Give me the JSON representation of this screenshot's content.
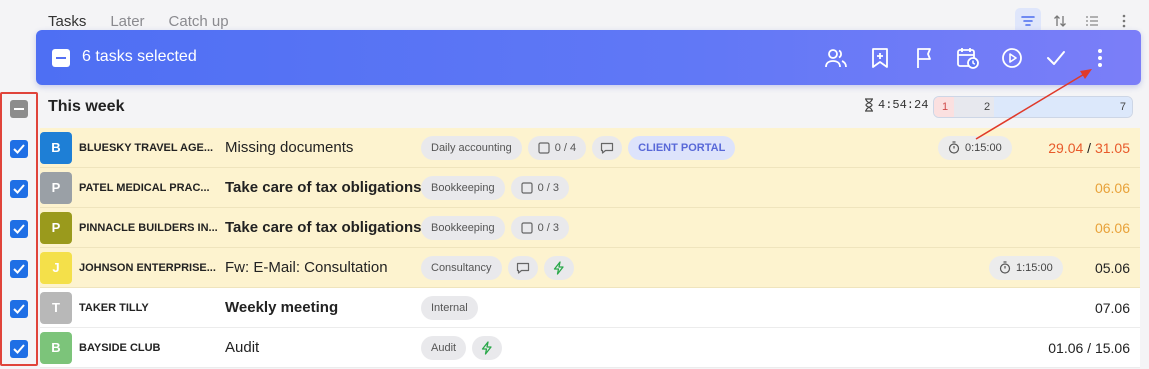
{
  "tabs": [
    "Tasks",
    "Later",
    "Catch up"
  ],
  "top_tools": [
    "filter-icon",
    "sort-icon",
    "list-view-icon",
    "more-vertical-icon"
  ],
  "selection": {
    "label": "6 tasks selected",
    "actions": [
      "assign-users-icon",
      "bookmark-add-icon",
      "flag-icon",
      "schedule-icon",
      "play-icon",
      "check-icon",
      "more-vertical-icon"
    ]
  },
  "section": {
    "title": "This week",
    "time": "4:54:24",
    "progress": {
      "overdue": "1",
      "middle": "2",
      "total": "7"
    }
  },
  "rows": [
    {
      "initial": "B",
      "avatar_color": "#1e7fd6",
      "client": "BLUESKY TRAVEL AGE...",
      "task": "Missing documents",
      "bold": false,
      "chips": [
        {
          "text": "Daily accounting"
        },
        {
          "icon": "checkbox",
          "text": "0 / 4"
        },
        {
          "icon": "comment",
          "text": ""
        },
        {
          "text": "CLIENT PORTAL",
          "portal": true
        }
      ],
      "timer": "0:15:00",
      "date_start": "29.04",
      "date_sep": " / ",
      "date_end": "31.05",
      "date_style": "red"
    },
    {
      "initial": "P",
      "avatar_color": "#9aa0a6",
      "client": "PATEL MEDICAL PRAC...",
      "task": "Take care of tax obligations",
      "bold": true,
      "chips": [
        {
          "text": "Bookkeeping"
        },
        {
          "icon": "checkbox",
          "text": "0 / 3"
        }
      ],
      "timer": "",
      "date": "06.06",
      "date_style": "orange"
    },
    {
      "initial": "P",
      "avatar_color": "#9a9a1c",
      "client": "PINNACLE BUILDERS IN...",
      "task": "Take care of tax obligations",
      "bold": true,
      "chips": [
        {
          "text": "Bookkeeping"
        },
        {
          "icon": "checkbox",
          "text": "0 / 3"
        }
      ],
      "timer": "",
      "date": "06.06",
      "date_style": "orange"
    },
    {
      "initial": "J",
      "avatar_color": "#f4e04a",
      "client": "JOHNSON ENTERPRISE...",
      "task": "Fw: E-Mail: Consultation",
      "bold": false,
      "chips": [
        {
          "text": "Consultancy"
        },
        {
          "icon": "comment",
          "text": ""
        },
        {
          "icon": "bolt",
          "text": ""
        }
      ],
      "timer": "1:15:00",
      "date": "05.06",
      "date_style": "normal"
    },
    {
      "initial": "T",
      "avatar_color": "#b8b8b8",
      "client": "TAKER TILLY",
      "task": "Weekly meeting",
      "bold": true,
      "plain": true,
      "chips": [
        {
          "text": "Internal"
        }
      ],
      "timer": "",
      "date": "07.06",
      "date_style": "normal"
    },
    {
      "initial": "B",
      "avatar_color": "#7cc47a",
      "client": "BAYSIDE CLUB",
      "task": "Audit",
      "bold": false,
      "plain": true,
      "chips": [
        {
          "text": "Audit"
        },
        {
          "icon": "bolt",
          "text": ""
        }
      ],
      "timer": "",
      "date": "01.06 / 15.06",
      "date_style": "normal"
    }
  ]
}
